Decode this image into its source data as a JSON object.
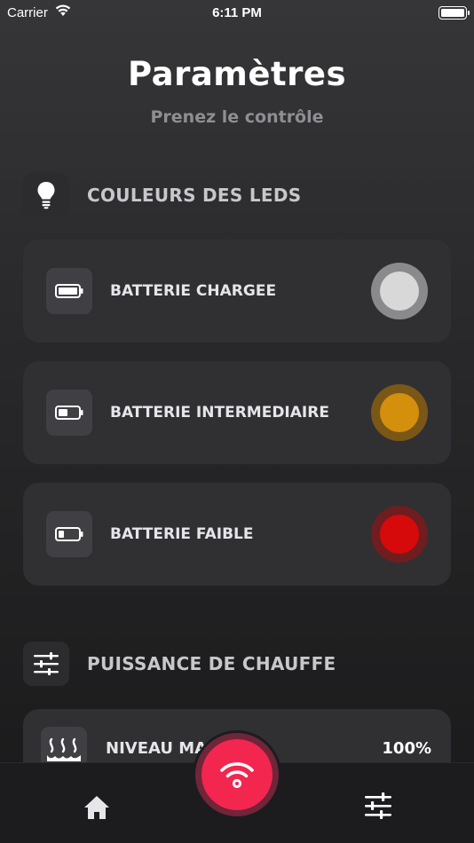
{
  "status_bar": {
    "carrier": "Carrier",
    "time": "6:11 PM"
  },
  "header": {
    "title": "Paramètres",
    "subtitle": "Prenez le contrôle"
  },
  "led_section": {
    "label": "COULEURS DES LEDS",
    "icon": "lightbulb-icon",
    "items": [
      {
        "label": "BATTERIE CHARGEE",
        "icon": "battery-full-icon",
        "color": "#d8d8d8",
        "ring": "#8a8a8c"
      },
      {
        "label": "BATTERIE INTERMEDIAIRE",
        "icon": "battery-half-icon",
        "color": "#d4900c",
        "ring": "#7a5716"
      },
      {
        "label": "BATTERIE FAIBLE",
        "icon": "battery-low-icon",
        "color": "#d60a0a",
        "ring": "#6f1d1f"
      }
    ]
  },
  "heat_section": {
    "label": "PUISSANCE DE CHAUFFE",
    "icon": "sliders-icon",
    "item": {
      "label": "NIVEAU MA",
      "value": "100%",
      "icon": "heat-waves-icon"
    }
  },
  "tab_bar": {
    "home_icon": "home-icon",
    "center_icon": "wifi-icon",
    "settings_icon": "sliders-icon"
  },
  "colors": {
    "accent": "#f2264f"
  }
}
